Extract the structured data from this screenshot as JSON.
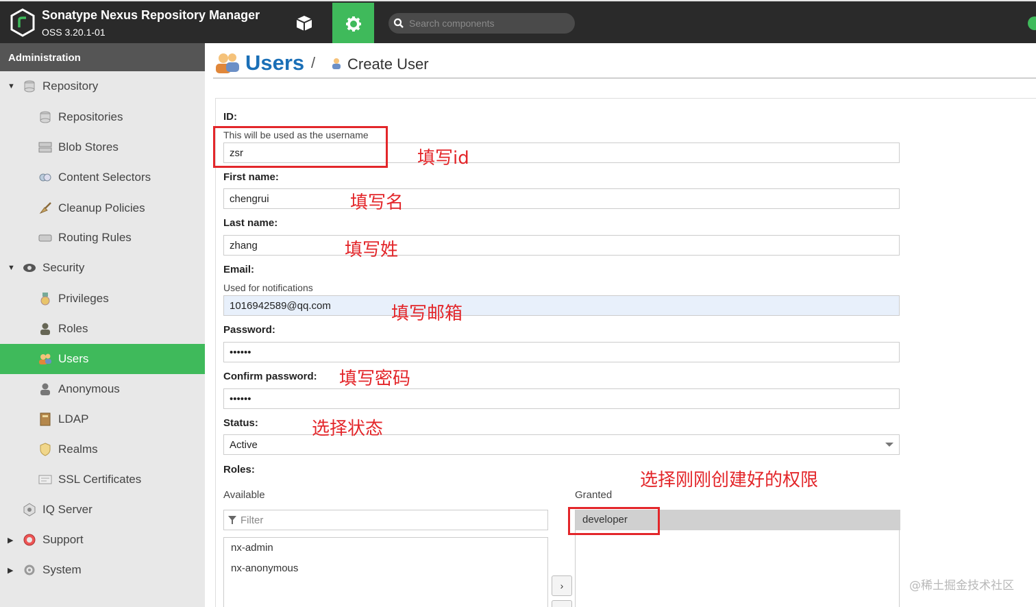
{
  "header": {
    "title": "Sonatype Nexus Repository Manager",
    "version": "OSS 3.20.1-01",
    "search_placeholder": "Search components"
  },
  "sidebar": {
    "heading": "Administration",
    "items": [
      {
        "label": "Repository",
        "icon": "database-icon"
      },
      {
        "label": "Repositories",
        "icon": "database-icon"
      },
      {
        "label": "Blob Stores",
        "icon": "server-icon"
      },
      {
        "label": "Content Selectors",
        "icon": "selector-icon"
      },
      {
        "label": "Cleanup Policies",
        "icon": "broom-icon"
      },
      {
        "label": "Routing Rules",
        "icon": "routing-icon"
      },
      {
        "label": "Security",
        "icon": "eye-icon"
      },
      {
        "label": "Privileges",
        "icon": "medal-icon"
      },
      {
        "label": "Roles",
        "icon": "role-icon"
      },
      {
        "label": "Users",
        "icon": "users-icon",
        "active": true
      },
      {
        "label": "Anonymous",
        "icon": "anonymous-icon"
      },
      {
        "label": "LDAP",
        "icon": "book-icon"
      },
      {
        "label": "Realms",
        "icon": "shield-icon"
      },
      {
        "label": "SSL Certificates",
        "icon": "certificate-icon"
      },
      {
        "label": "IQ Server",
        "icon": "iq-icon"
      },
      {
        "label": "Support",
        "icon": "lifebuoy-icon"
      },
      {
        "label": "System",
        "icon": "gear-icon"
      }
    ]
  },
  "breadcrumb": {
    "title": "Users",
    "separator": "/",
    "sub": "Create User"
  },
  "form": {
    "id_label": "ID:",
    "id_help": "This will be used as the username",
    "id_value": "zsr",
    "first_name_label": "First name:",
    "first_name_value": "chengrui",
    "last_name_label": "Last name:",
    "last_name_value": "zhang",
    "email_label": "Email:",
    "email_help": "Used for notifications",
    "email_value": "1016942589@qq.com",
    "password_label": "Password:",
    "password_value": "••••••",
    "confirm_label": "Confirm password:",
    "confirm_value": "••••••",
    "status_label": "Status:",
    "status_value": "Active",
    "roles_label": "Roles:",
    "available_label": "Available",
    "granted_label": "Granted",
    "filter_placeholder": "Filter",
    "available_roles": [
      "nx-admin",
      "nx-anonymous"
    ],
    "granted_roles": [
      "developer"
    ],
    "move_right": "›"
  },
  "annotations": {
    "id": "填写id",
    "first_name": "填写名",
    "last_name": "填写姓",
    "email": "填写邮箱",
    "password": "填写密码",
    "status": "选择状态",
    "roles": "选择刚刚创建好的权限"
  },
  "watermark": "@稀土掘金技术社区",
  "colors": {
    "accent": "#3fba5b",
    "header_bg": "#2a2a2a",
    "title_blue": "#1a6fb7",
    "annotation_red": "#e3262a"
  }
}
